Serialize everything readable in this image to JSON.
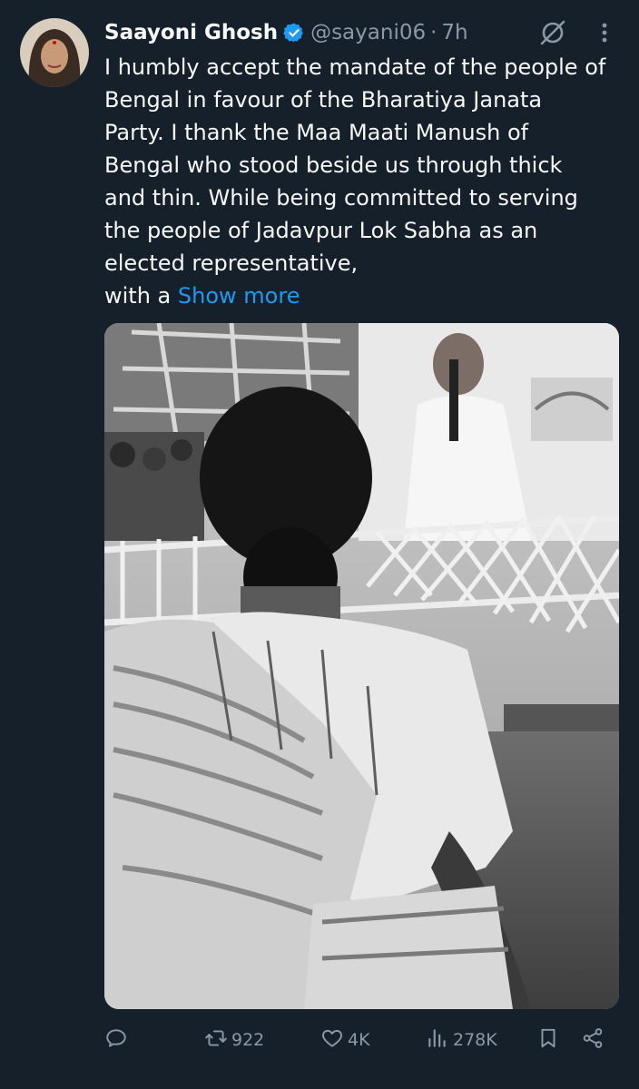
{
  "author": {
    "display_name": "Saayoni Ghosh",
    "handle": "@sayani06",
    "separator": "·",
    "time": "7h",
    "verified": true,
    "verified_color": "#1d9bf0"
  },
  "tweet": {
    "lines": [
      "I humbly accept the mandate of the people of",
      "Bengal in favour of the Bharatiya Janata",
      "Party. I thank the Maa Maati Manush of",
      "Bengal who stood beside us through thick",
      "and thin. While being committed to serving",
      "the people of Jadavpur Lok Sabha as an",
      "elected representative,"
    ],
    "last_line_prefix": "with a",
    "show_more": "Show more"
  },
  "actions": {
    "reply_count": "",
    "retweet_count": "922",
    "like_count": "4K",
    "views_count": "278K"
  },
  "icons": {
    "header": [
      "grok-icon",
      "more-options-icon"
    ],
    "actions": [
      "reply-icon",
      "retweet-icon",
      "like-icon",
      "views-icon",
      "bookmark-icon",
      "share-icon"
    ]
  },
  "colors": {
    "background": "#15202b",
    "text": "#f7f9f9",
    "secondary": "#8b98a5",
    "link": "#1d9bf0"
  }
}
